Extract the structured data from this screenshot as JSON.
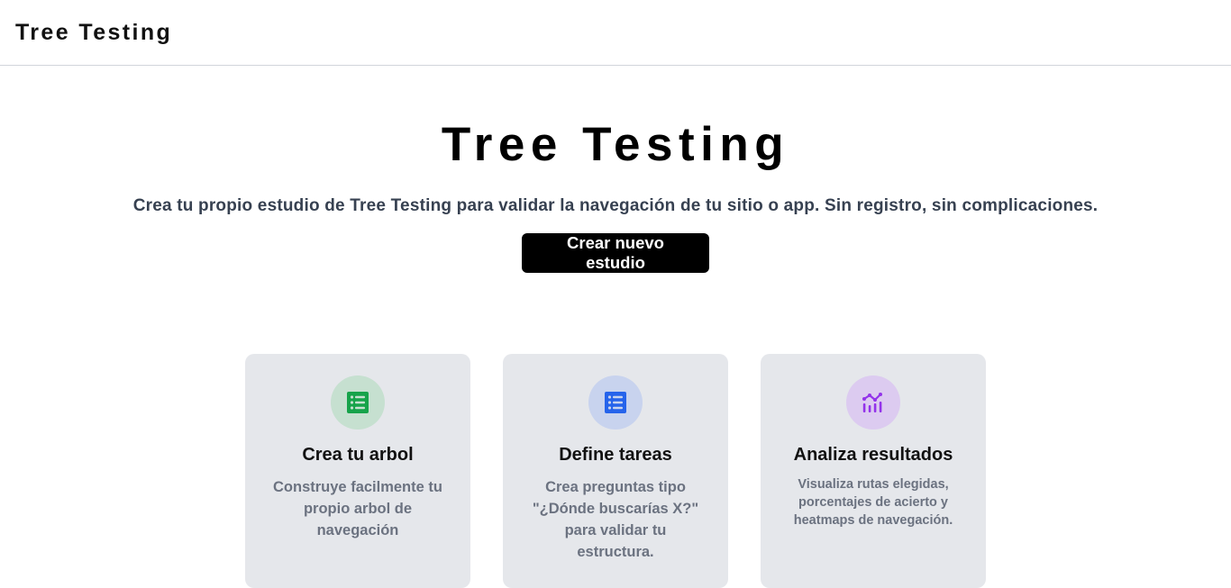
{
  "header": {
    "brand": "Tree Testing"
  },
  "hero": {
    "title": "Tree Testing",
    "subtitle": "Crea tu propio estudio de Tree Testing para validar la navegación de tu sitio o app. Sin registro, sin complicaciones.",
    "cta_label": "Crear nuevo estudio"
  },
  "features": [
    {
      "icon": "list-icon",
      "icon_color": "#16a34a",
      "icon_bg": "#c6e0d0",
      "title": "Crea tu arbol",
      "description": "Construye facilmente tu propio arbol de navegación"
    },
    {
      "icon": "list-icon",
      "icon_color": "#2563eb",
      "icon_bg": "#c8d3ee",
      "title": "Define tareas",
      "description": "Crea preguntas tipo \"¿Dónde buscarías X?\" para validar tu estructura."
    },
    {
      "icon": "analytics-icon",
      "icon_color": "#9333ea",
      "icon_bg": "#dccbf0",
      "title": "Analiza resultados",
      "description": "Visualiza rutas elegidas, porcentajes de acierto y heatmaps de navegación."
    }
  ]
}
